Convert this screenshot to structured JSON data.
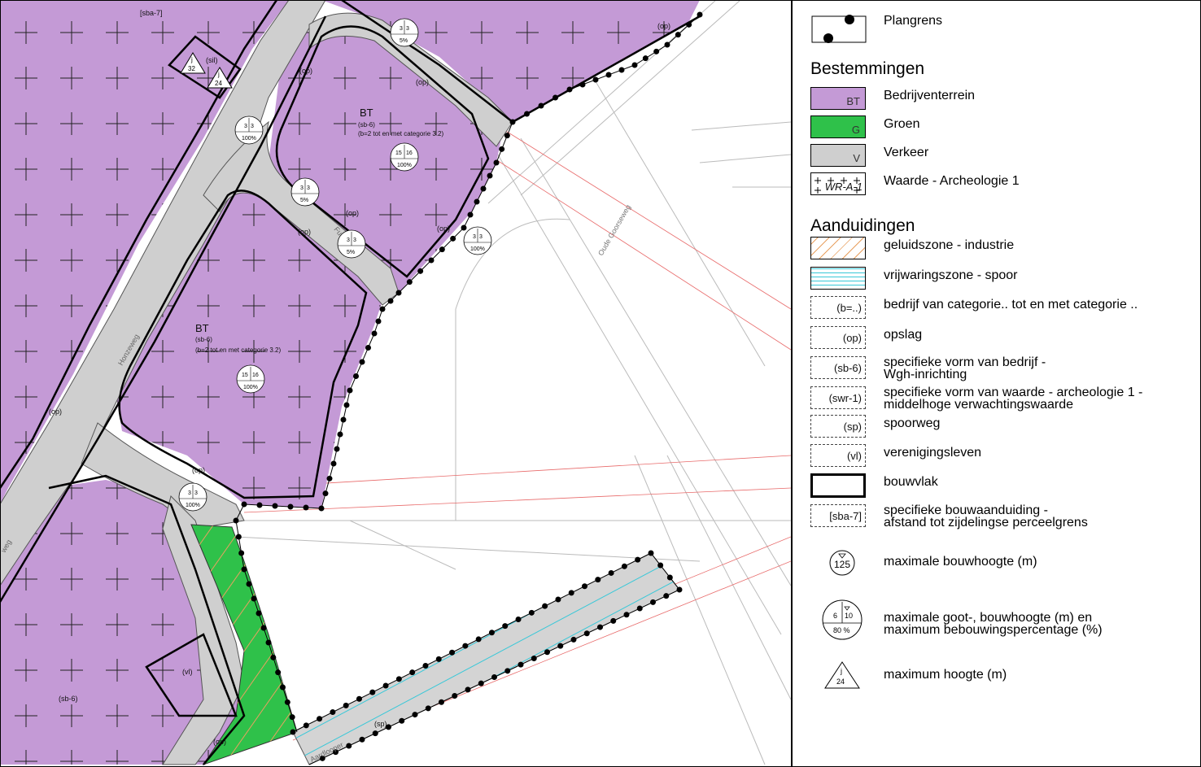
{
  "map": {
    "labels": {
      "bt_1_code": "BT",
      "bt_1_sb": "(sb-6)",
      "bt_1_b": "(b=2 tot en met categorie 3.2)",
      "bt_2_code": "BT",
      "bt_2_sb": "(sb-6)",
      "bt_2_b": "(b=2 tot en met categorie 3.2)",
      "sba": "[sba-7]",
      "sil": "(sil)",
      "op": "(op)",
      "vl": "(vl)",
      "sb6_low": "(sb-6)",
      "sp": "(sp)",
      "street_honzeweg": "Honzeweg",
      "street_fuutweg": "Fuutweg",
      "street_oude": "Oude Goorseweg",
      "street_aard": "Aardlooper",
      "street_w": "weg"
    },
    "symbols": [
      {
        "goot": "3",
        "bouw": "3",
        "pct": "5%"
      },
      {
        "goot": "3",
        "bouw": "3",
        "pct": "100%"
      },
      {
        "goot": "15",
        "bouw": "16",
        "pct": "100%"
      },
      {
        "goot": "3",
        "bouw": "3",
        "pct": "5%"
      },
      {
        "goot": "3",
        "bouw": "3",
        "pct": "5%"
      },
      {
        "goot": "3",
        "bouw": "3",
        "pct": "100%"
      },
      {
        "goot": "15",
        "bouw": "16",
        "pct": "100%"
      },
      {
        "goot": "3",
        "bouw": "3",
        "pct": "100%"
      }
    ],
    "triangles": [
      {
        "letter": "j",
        "value": "32"
      },
      {
        "letter": "j",
        "value": "24"
      }
    ],
    "colors": {
      "bedrijf": "#c49ad6",
      "groen": "#2fc14a",
      "verkeer": "#cfcfcf",
      "cadastral": "#e86a6a",
      "spoor": "#38c8d8",
      "industrie": "#e8a060"
    }
  },
  "legend": {
    "plangrens": "Plangrens",
    "bestemmingen_title": "Bestemmingen",
    "bestemmingen": [
      {
        "label": "Bedrijventerrein",
        "code": "BT",
        "color": "#c49ad6"
      },
      {
        "label": "Groen",
        "code": "G",
        "color": "#2fc14a"
      },
      {
        "label": "Verkeer",
        "code": "V",
        "color": "#cfcfcf"
      },
      {
        "label": "Waarde - Archeologie 1",
        "code": "WR-A-1",
        "color": "#ffffff"
      }
    ],
    "aanduidingen_title": "Aanduidingen",
    "aanduidingen": [
      {
        "label": "geluidszone - industrie",
        "code": ""
      },
      {
        "label": "vrijwaringszone - spoor",
        "code": ""
      },
      {
        "label": "bedrijf van categorie.. tot en met categorie ..",
        "code": "(b=..)"
      },
      {
        "label": "opslag",
        "code": "(op)"
      },
      {
        "label": "specifieke vorm van bedrijf -",
        "label2": "Wgh-inrichting",
        "code": "(sb-6)"
      },
      {
        "label": "specifieke vorm van waarde - archeologie 1 -",
        "label2": "middelhoge verwachtingswaarde",
        "code": "(swr-1)"
      },
      {
        "label": "spoorweg",
        "code": "(sp)"
      },
      {
        "label": "verenigingsleven",
        "code": "(vl)"
      },
      {
        "label": "bouwvlak",
        "code": ""
      },
      {
        "label": "specifieke bouwaanduiding -",
        "label2": "afstand tot zijdelingse perceelgrens",
        "code": "[sba-7]"
      }
    ],
    "symbols": {
      "bouwhoogte_label": "maximale bouwhoogte (m)",
      "bouwhoogte_value": "125",
      "goot_label": "maximale goot-, bouwhoogte (m) en",
      "goot_label2": "maximum bebouwingspercentage (%)",
      "goot_value": "6",
      "bouw_value": "10",
      "pct_value": "80 %",
      "hoogte_label": "maximum hoogte (m)",
      "hoogte_letter": "j",
      "hoogte_value": "24"
    }
  }
}
